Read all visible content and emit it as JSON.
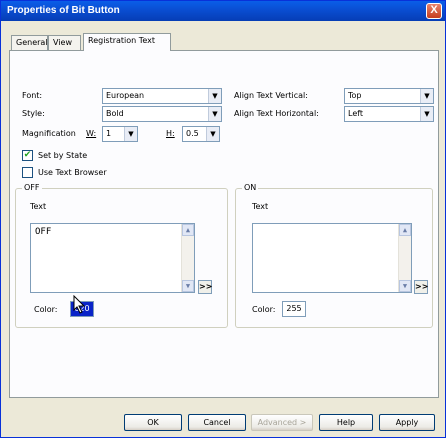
{
  "window": {
    "title": "Properties of Bit Button",
    "close_glyph": "X"
  },
  "tabs": [
    {
      "label": "General"
    },
    {
      "label": "View"
    },
    {
      "label": "Registration Text"
    }
  ],
  "form": {
    "font_label": "Font:",
    "font_value": "European",
    "style_label": "Style:",
    "style_value": "Bold",
    "magnification_label": "Magnification",
    "w_label": "W:",
    "w_value": "1",
    "h_label": "H:",
    "h_value": "0.5",
    "align_vertical_label": "Align Text Vertical:",
    "align_vertical_value": "Top",
    "align_horizontal_label": "Align Text Horizontal:",
    "align_horizontal_value": "Left",
    "set_by_state_label": "Set by State",
    "set_by_state_checked": true,
    "use_text_browser_label": "Use Text Browser",
    "use_text_browser_checked": false
  },
  "off_group": {
    "title": "OFF",
    "text_label": "Text",
    "text_value": "OFF",
    "expand_label": ">>",
    "color_label": "Color:",
    "color_value": "020",
    "color_bg": "#0a24c8"
  },
  "on_group": {
    "title": "ON",
    "text_label": "Text",
    "text_value": "",
    "expand_label": ">>",
    "color_label": "Color:",
    "color_value": "255",
    "color_bg": "#ffffff"
  },
  "buttons": {
    "ok": "OK",
    "cancel": "Cancel",
    "advanced": "Advanced >",
    "help": "Help",
    "apply": "Apply"
  },
  "icons": {
    "dropdown": "chevron-down-icon",
    "checkmark": "checkmark-icon",
    "cursor": "mouse-pointer-icon"
  }
}
